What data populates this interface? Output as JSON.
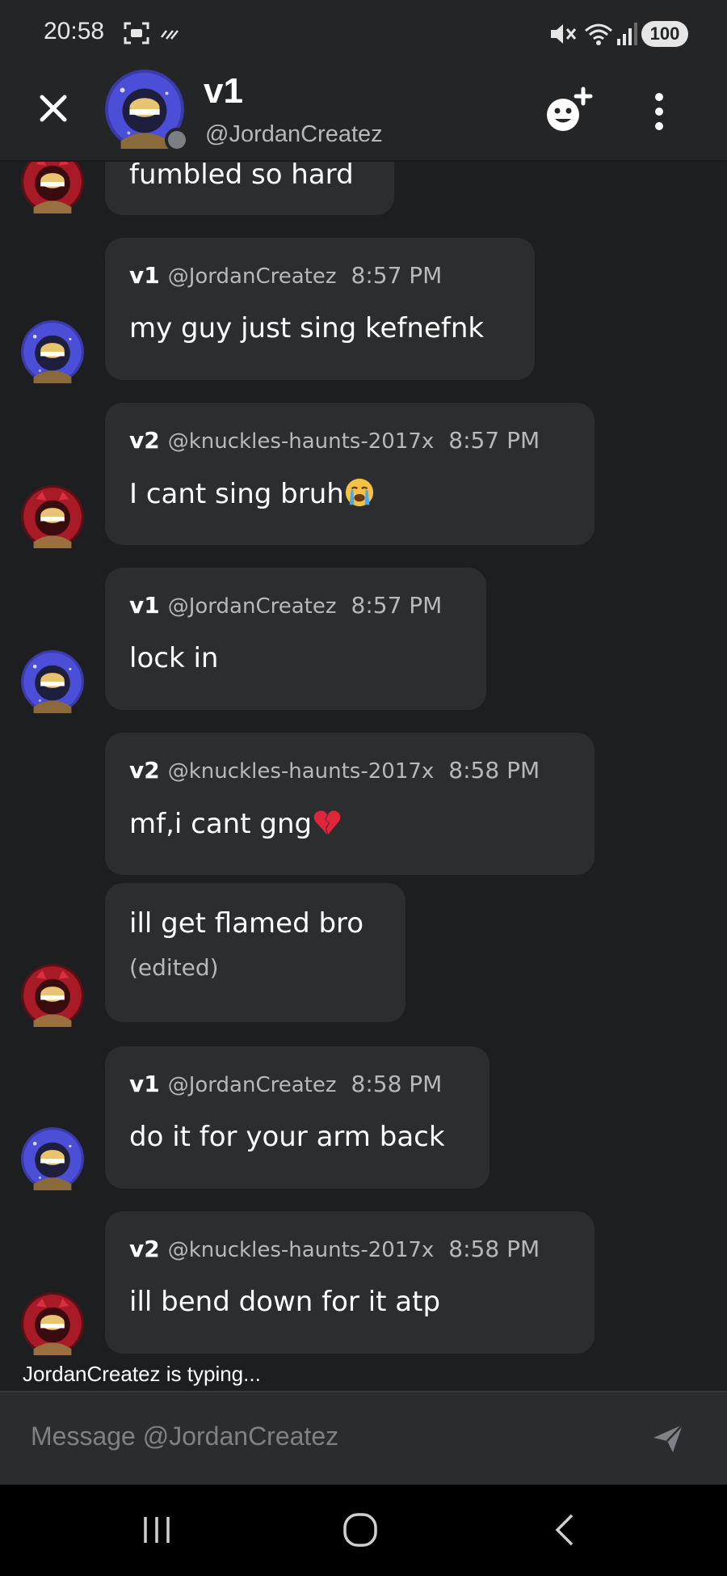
{
  "status_bar": {
    "time": "20:58",
    "battery": "100"
  },
  "header": {
    "name": "v1",
    "handle": "@JordanCreatez",
    "close_icon": "close-icon",
    "add_friend_icon": "add-friend-icon",
    "more_icon": "more-vertical-icon"
  },
  "messages": [
    {
      "author": "v2",
      "partial": true,
      "text": "fumbled so hard"
    },
    {
      "author": "v1",
      "handle": "@JordanCreatez",
      "time": "8:57 PM",
      "text": "my guy just sing kefnefnk"
    },
    {
      "author": "v2",
      "handle": "@knuckles-haunts-2017x",
      "time": "8:57 PM",
      "text": "I cant sing bruh",
      "emoji": "loudly-crying-emoji"
    },
    {
      "author": "v1",
      "handle": "@JordanCreatez",
      "time": "8:57 PM",
      "text": "lock in"
    },
    {
      "author": "v2",
      "handle": "@knuckles-haunts-2017x",
      "time": "8:58 PM",
      "text": "mf,i cant gng",
      "emoji": "broken-heart-emoji"
    },
    {
      "author": "v2",
      "continuation": true,
      "text": "ill get flamed bro",
      "edited": "(edited)"
    },
    {
      "author": "v1",
      "handle": "@JordanCreatez",
      "time": "8:58 PM",
      "text": "do it for your arm back"
    },
    {
      "author": "v2",
      "handle": "@knuckles-haunts-2017x",
      "time": "8:58 PM",
      "text": "ill bend down for it atp"
    }
  ],
  "typing_indicator": "JordanCreatez is typing...",
  "composer": {
    "placeholder": "Message @JordanCreatez",
    "send_icon": "send-icon"
  },
  "colors": {
    "background": "#1c1e1f",
    "header": "#232526",
    "bubble": "#2b2d2f",
    "muted_text": "#b5b9bd",
    "v1_avatar": "#3b3fc4",
    "v2_avatar": "#b01e2e"
  }
}
